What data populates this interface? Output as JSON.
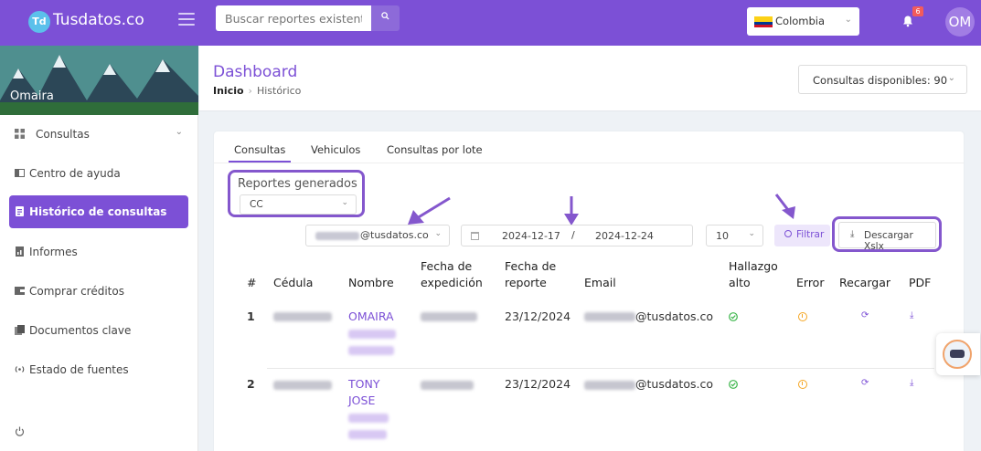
{
  "app": {
    "logo_mark": "Td",
    "logo_text": "Tusdatos.co"
  },
  "topbar": {
    "search_placeholder": "Buscar reportes existentes",
    "country": "Colombia",
    "notification_count": "6",
    "avatar_initials": "OM"
  },
  "sidebar": {
    "profile_name": "Omaira",
    "items": [
      {
        "label": "Consultas",
        "icon": "grid-icon"
      },
      {
        "label": "Centro de ayuda",
        "icon": "help-icon"
      },
      {
        "label": "Histórico de consultas",
        "icon": "history-icon"
      },
      {
        "label": "Informes",
        "icon": "report-icon"
      },
      {
        "label": "Comprar créditos",
        "icon": "wallet-icon"
      },
      {
        "label": "Documentos clave",
        "icon": "documents-icon"
      },
      {
        "label": "Estado de fuentes",
        "icon": "signal-icon"
      }
    ]
  },
  "header": {
    "title": "Dashboard",
    "breadcrumb": {
      "home": "Inicio",
      "current": "Histórico"
    },
    "credits": "Consultas disponibles: 90"
  },
  "tabs": [
    "Consultas",
    "Vehiculos",
    "Consultas por lote"
  ],
  "reports": {
    "label": "Reportes generados",
    "selected": "CC"
  },
  "filters": {
    "email_suffix": "@tusdatos.co",
    "date_from": "2024-12-17",
    "date_separator": "/",
    "date_to": "2024-12-24",
    "page_size": "10",
    "filter_label": "Filtrar",
    "download_label": "Descargar Xslx"
  },
  "table": {
    "headers": {
      "num": "#",
      "cedula": "Cédula",
      "nombre": "Nombre",
      "fecha_exp_1": "Fecha de",
      "fecha_exp_2": "expedición",
      "fecha_rep_1": "Fecha de",
      "fecha_rep_2": "reporte",
      "email": "Email",
      "hallazgo_1": "Hallazgo",
      "hallazgo_2": "alto",
      "error": "Error",
      "recargar": "Recargar",
      "pdf": "PDF"
    },
    "rows": [
      {
        "num": "1",
        "name_line1": "OMAIRA",
        "name_line2": "",
        "report_date": "23/12/2024",
        "email_suffix": "@tusdatos.co",
        "hallazgo": "check-icon",
        "error": "warning-icon",
        "reload": "reload-icon",
        "pdf": "download-icon"
      },
      {
        "num": "2",
        "name_line1": "TONY",
        "name_line2": "JOSE",
        "report_date": "23/12/2024",
        "email_suffix": "@tusdatos.co",
        "hallazgo": "check-icon",
        "error": "warning-icon",
        "reload": "reload-icon",
        "pdf": "download-icon"
      }
    ]
  },
  "colors": {
    "brand": "#7c50d6",
    "success": "#3bb54a",
    "warning": "#f5a623",
    "badge": "#f35b5b"
  }
}
